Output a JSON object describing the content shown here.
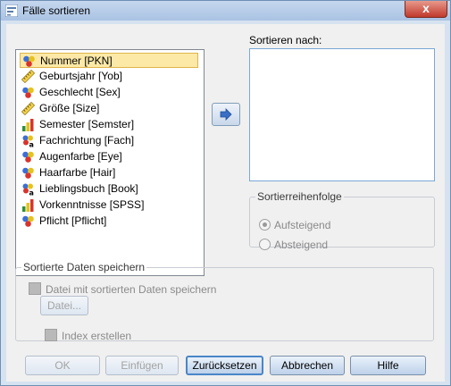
{
  "window": {
    "title": "Fälle sortieren",
    "close_glyph": "x"
  },
  "variables": [
    {
      "label": "Nummer [PKN]",
      "icon": "nominal-icon",
      "selected": true
    },
    {
      "label": "Geburtsjahr [Yob]",
      "icon": "scale-icon"
    },
    {
      "label": "Geschlecht [Sex]",
      "icon": "nominal-icon"
    },
    {
      "label": "Größe [Size]",
      "icon": "scale-icon"
    },
    {
      "label": "Semester [Semster]",
      "icon": "ordinal-icon"
    },
    {
      "label": "Fachrichtung [Fach]",
      "icon": "nominal-string-icon"
    },
    {
      "label": "Augenfarbe [Eye]",
      "icon": "nominal-icon"
    },
    {
      "label": "Haarfarbe [Hair]",
      "icon": "nominal-icon"
    },
    {
      "label": "Lieblingsbuch [Book]",
      "icon": "nominal-string-icon"
    },
    {
      "label": "Vorkenntnisse [SPSS]",
      "icon": "ordinal-icon"
    },
    {
      "label": "Pflicht [Pflicht]",
      "icon": "nominal-icon"
    }
  ],
  "sort": {
    "label": "Sortieren nach:"
  },
  "order": {
    "legend": "Sortierreihenfolge",
    "ascending": "Aufsteigend",
    "descending": "Absteigend",
    "selected": "ascending"
  },
  "save": {
    "legend": "Sortierte Daten speichern",
    "save_checkbox": "Datei mit sortierten Daten speichern",
    "file_button": "Datei...",
    "index_checkbox": "Index erstellen"
  },
  "buttons": {
    "ok": "OK",
    "paste": "Einfügen",
    "reset": "Zurücksetzen",
    "cancel": "Abbrechen",
    "help": "Hilfe"
  }
}
